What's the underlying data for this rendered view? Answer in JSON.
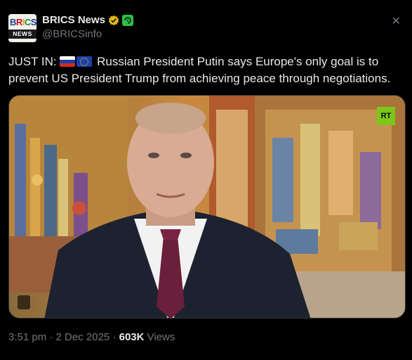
{
  "header": {
    "avatar_logo_top": "BRICS",
    "avatar_logo_bottom": "NEWS",
    "display_name": "BRICS News",
    "handle": "@BRICSinfo",
    "close_icon": "x-icon"
  },
  "tweet": {
    "prefix": "JUST IN:",
    "flags": [
      "russia-flag",
      "eu-flag"
    ],
    "body": "Russian President Putin says Europe's only goal is to prevent US President Trump from achieving peace through negotiations."
  },
  "media": {
    "watermark": "RT"
  },
  "meta": {
    "time": "3:51 pm",
    "sep1": " · ",
    "date": "2 Dec 2025",
    "sep2": " · ",
    "views_count": "603K",
    "views_label": " Views"
  },
  "colors": {
    "background": "#000000",
    "text": "#e7e9ea",
    "muted": "#71767b",
    "verified_gold": "#e2b719",
    "affiliate_green": "#2fbf4a",
    "rt_green": "#7cc519"
  }
}
